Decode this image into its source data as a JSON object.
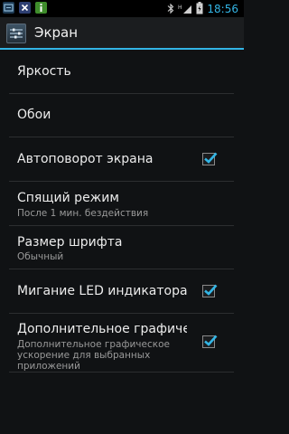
{
  "status_bar": {
    "clock": "18:56",
    "notifications": [
      "usb-debug-icon",
      "close-x-icon",
      "info-icon"
    ],
    "right_icons": [
      "bluetooth-icon",
      "signal-h-icon",
      "battery-icon"
    ]
  },
  "action_bar": {
    "title": "Экран"
  },
  "settings": [
    {
      "title": "Яркость"
    },
    {
      "title": "Обои"
    },
    {
      "title": "Автоповорот экрана",
      "checked": true
    },
    {
      "title": "Спящий режим",
      "summary": "После 1 мин. бездействия"
    },
    {
      "title": "Размер шрифта",
      "summary": "Обычный"
    },
    {
      "title": "Мигание LED индикатора",
      "checked": true
    },
    {
      "title": "Дополнительное графическое",
      "summary_lines": [
        "Дополнительное графическое",
        "ускорение для выбранных",
        "приложений"
      ],
      "checked": true
    }
  ],
  "colors": {
    "accent": "#33b5e5",
    "background": "#101214"
  }
}
